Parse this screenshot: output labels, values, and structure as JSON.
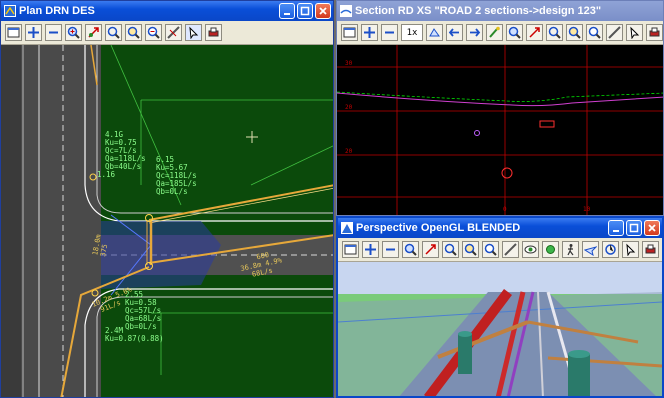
{
  "windows": {
    "plan": {
      "title": "Plan DRN DES"
    },
    "section": {
      "title": "Section RD XS \"ROAD 2 sections->design 123\"",
      "scale_field": "1x"
    },
    "perspective": {
      "title": "Perspective OpenGL BLENDED"
    }
  },
  "plan_labels": {
    "pit_a": [
      "4.1G",
      "Ku=0.75",
      "Qc=7L/s",
      "Qa=118L/s",
      "Qb=40L/s"
    ],
    "pit_b": [
      "6.15",
      "Ku=5.67",
      "Qc=118L/s",
      "Qa=185L/s",
      "Qb=0L/s"
    ],
    "pit_c": [
      "2.55",
      "Ku=0.58",
      "Qc=57L/s",
      "Qa=68L/s",
      "Qb=0L/s"
    ],
    "pit_d": [
      "2.4M",
      "Ku=0.87(0.88)"
    ],
    "pipe_east": [
      "600",
      "36.8m 4.9%",
      "68L/s"
    ],
    "pipe_sw": [
      "10.2m 5.6%",
      "91L/s"
    ],
    "misc": [
      "1.16",
      "375",
      "18.0m"
    ]
  },
  "section_axis": {
    "y_ticks": [
      "30",
      "20",
      "20"
    ],
    "x_ticks": [
      "0",
      "10"
    ]
  },
  "icons": {
    "plan_toolbar": [
      "window-icon",
      "pan-icon",
      "minus-icon",
      "zoom-in-icon",
      "zoom-fit-icon",
      "zoom-window-icon",
      "zoom-previous-icon",
      "zoom-out-icon",
      "measure-icon",
      "pointer-icon",
      "print-icon"
    ]
  },
  "colors": {
    "cad_bg": "#0b4a0b",
    "cad_text": "#8cff8c",
    "section_bg": "#000000",
    "grid_red": "#c00000"
  }
}
